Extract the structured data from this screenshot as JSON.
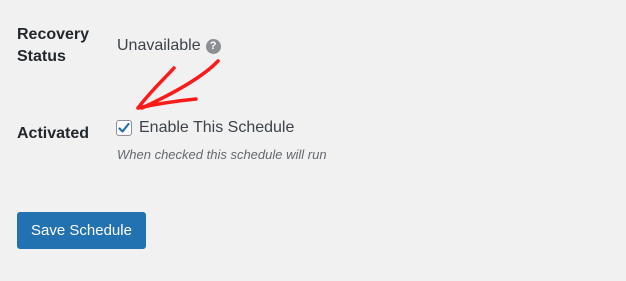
{
  "recovery": {
    "label": "Recovery Status",
    "value": "Unavailable",
    "help_icon": "?"
  },
  "activated": {
    "label": "Activated",
    "checkbox_checked": true,
    "checkbox_label": "Enable This Schedule",
    "description": "When checked this schedule will run"
  },
  "actions": {
    "save_label": "Save Schedule"
  },
  "colors": {
    "background": "#f1f1f1",
    "primary_button": "#2271b1",
    "checkmark": "#2271b1",
    "annotation_arrow": "#ff0000"
  },
  "icons": {
    "help": "question-circle-icon",
    "check": "checkmark-icon",
    "annotation": "red-arrow-icon"
  }
}
